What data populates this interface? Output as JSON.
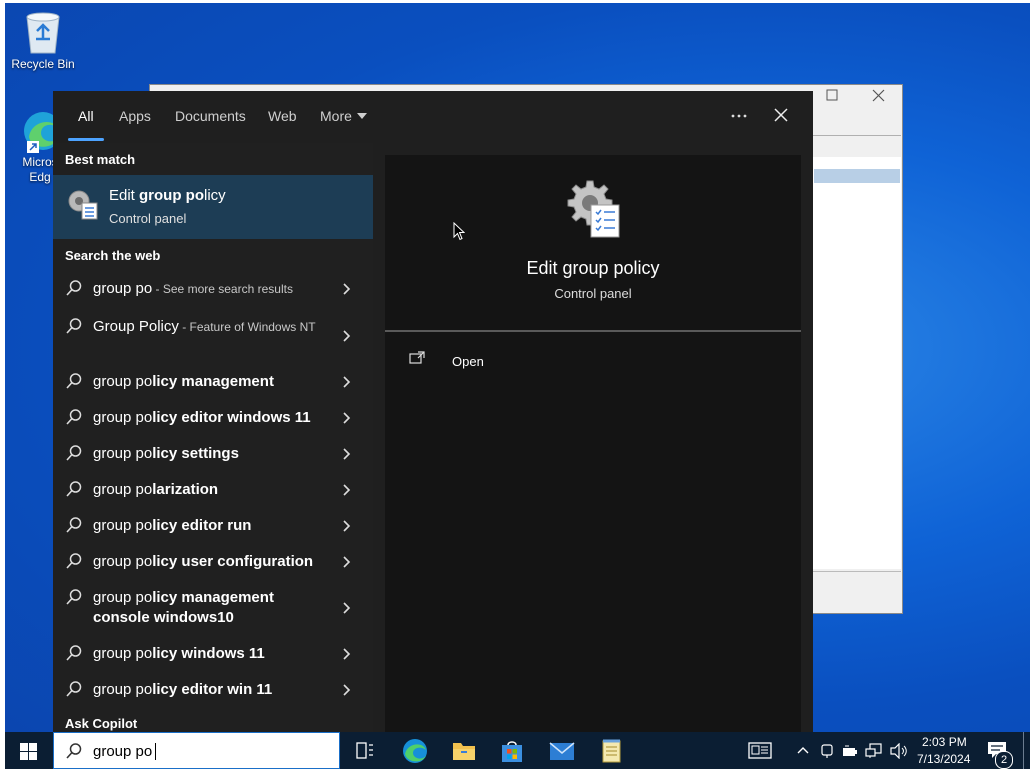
{
  "desktop": {
    "icons": [
      {
        "label": "Recycle Bin"
      },
      {
        "label": "Microsoft Edge",
        "label_visible": "Micros Edg"
      }
    ]
  },
  "search_panel": {
    "tabs": [
      {
        "label": "All",
        "active": true
      },
      {
        "label": "Apps"
      },
      {
        "label": "Documents"
      },
      {
        "label": "Web"
      },
      {
        "label": "More"
      }
    ],
    "best_match_heading": "Best match",
    "best_match": {
      "title_prefix": "Edit ",
      "title_bold": "group po",
      "title_suffix": "licy",
      "subtitle": "Control panel"
    },
    "web_heading": "Search the web",
    "web_results": [
      {
        "text": "group po",
        "bold": "",
        "sub": " - See more search results"
      },
      {
        "text": "Group Policy",
        "bold": "",
        "sub": " - Feature of Windows NT"
      },
      {
        "text": "group po",
        "bold": "licy management",
        "sub": ""
      },
      {
        "text": "group po",
        "bold": "licy editor windows 11",
        "sub": ""
      },
      {
        "text": "group po",
        "bold": "licy settings",
        "sub": ""
      },
      {
        "text": "group po",
        "bold": "larization",
        "sub": ""
      },
      {
        "text": "group po",
        "bold": "licy editor run",
        "sub": ""
      },
      {
        "text": "group po",
        "bold": "licy user configuration",
        "sub": ""
      },
      {
        "text": "group po",
        "bold": "licy management console windows10",
        "sub": ""
      },
      {
        "text": "group po",
        "bold": "licy windows 11",
        "sub": ""
      },
      {
        "text": "group po",
        "bold": "licy editor win 11",
        "sub": ""
      }
    ],
    "copilot_heading": "Ask Copilot",
    "preview": {
      "title": "Edit group policy",
      "subtitle": "Control panel",
      "action_open": "Open"
    }
  },
  "taskbar": {
    "search_value": "group po",
    "clock_time": "2:03 PM",
    "clock_date": "7/13/2024",
    "notification_count": "2"
  },
  "colors": {
    "accent": "#4da3ff",
    "selected_row": "#1d3d55",
    "panel_bg": "#1f1f1f",
    "taskbar_bg": "#0b1e33"
  }
}
